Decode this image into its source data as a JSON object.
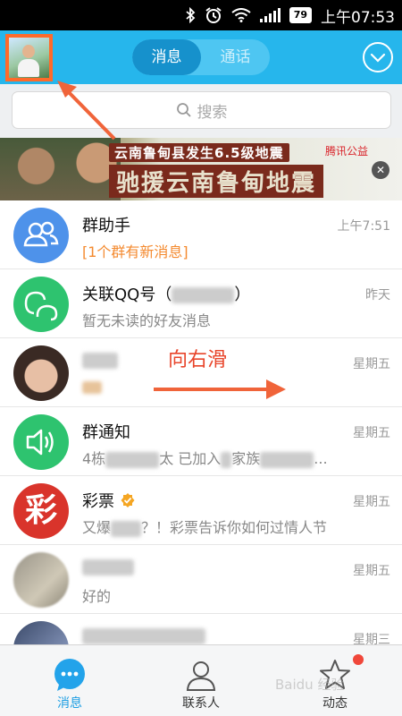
{
  "status_bar": {
    "battery": "79",
    "time": "上午07:53"
  },
  "header": {
    "tabs": [
      {
        "label": "消息",
        "active": true
      },
      {
        "label": "通话",
        "active": false
      }
    ]
  },
  "search": {
    "placeholder": "搜索"
  },
  "banner": {
    "line1": "云南鲁甸县发生6.5级地震",
    "line2": "驰援云南鲁甸地震",
    "logo": "腾讯公益"
  },
  "conversations": [
    {
      "name": "群助手",
      "message": "[1个群有新消息]",
      "time": "上午7:51",
      "highlight": true
    },
    {
      "name": "关联QQ号（",
      "name_suffix": "）",
      "message": "暂无未读的好友消息",
      "time": "昨天"
    },
    {
      "name": "",
      "message": "",
      "time": "星期五"
    },
    {
      "name": "群通知",
      "message_prefix": "4栋",
      "message_mid": "太 已加入",
      "message_end": "家族",
      "message_tail": "...",
      "time": "星期五"
    },
    {
      "name": "彩票",
      "message": "又爆",
      "message_rest": "？！彩票告诉你如何过情人节",
      "time": "星期五",
      "avatar_text": "彩"
    },
    {
      "name": "",
      "message": "好的",
      "time": "星期五"
    },
    {
      "name": "",
      "message": "",
      "time": "星期三"
    }
  ],
  "annotation": {
    "swipe_hint": "向右滑"
  },
  "tab_bar": {
    "tabs": [
      {
        "label": "消息",
        "active": true
      },
      {
        "label": "联系人",
        "active": false
      },
      {
        "label": "动态",
        "active": false
      }
    ]
  },
  "watermark": "Baidu 经验",
  "colors": {
    "header": "#26b6ec",
    "accent_orange": "#f48a2f",
    "annotation": "#e8452b"
  }
}
